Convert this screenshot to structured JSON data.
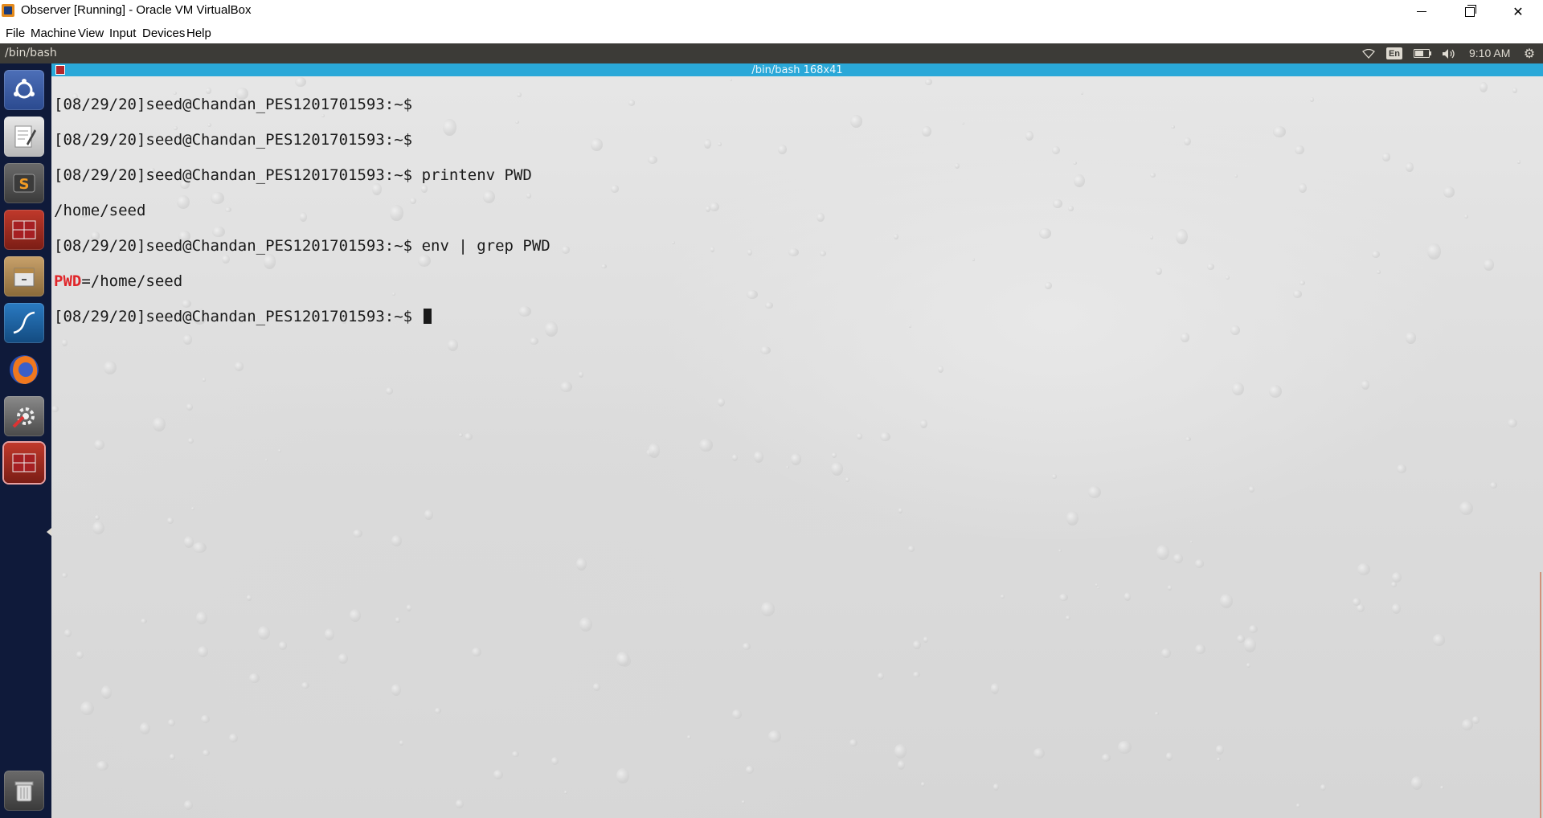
{
  "window": {
    "title": "Observer [Running] - Oracle VM VirtualBox",
    "controls": [
      "minimize",
      "maximize",
      "close"
    ]
  },
  "menubar": {
    "items": [
      "File",
      "Machine",
      "View",
      "Input",
      "Devices",
      "Help"
    ]
  },
  "panel": {
    "title": "/bin/bash",
    "lang": "En",
    "clock": "9:10 AM",
    "battery_level": 0.6,
    "icons": [
      "wifi-icon",
      "keyboard-layout-icon",
      "battery-icon",
      "volume-icon",
      "settings-gear-icon"
    ]
  },
  "launcher": {
    "items": [
      {
        "name": "ubuntu-dash",
        "icon": "ubuntu-logo-icon"
      },
      {
        "name": "text-editor",
        "icon": "text-editor-icon"
      },
      {
        "name": "sublime-text",
        "icon": "sublime-text-icon"
      },
      {
        "name": "terminal",
        "icon": "terminal-icon"
      },
      {
        "name": "files",
        "icon": "file-cabinet-icon"
      },
      {
        "name": "wireshark",
        "icon": "wireshark-fin-icon"
      },
      {
        "name": "firefox",
        "icon": "firefox-icon"
      },
      {
        "name": "system-settings",
        "icon": "wrench-gear-icon"
      },
      {
        "name": "terminal-active",
        "icon": "terminal-icon"
      },
      {
        "name": "trash",
        "icon": "trash-icon"
      }
    ]
  },
  "terminal": {
    "title": "/bin/bash 168x41",
    "lines": [
      {
        "prompt": "[08/29/20]seed@Chandan_PES1201701593:~$",
        "command": ""
      },
      {
        "prompt": "[08/29/20]seed@Chandan_PES1201701593:~$",
        "command": ""
      },
      {
        "prompt": "[08/29/20]seed@Chandan_PES1201701593:~$",
        "command": " printenv PWD"
      },
      {
        "output": "/home/seed"
      },
      {
        "prompt": "[08/29/20]seed@Chandan_PES1201701593:~$",
        "command": " env | grep PWD"
      },
      {
        "highlight": "PWD",
        "output": "=/home/seed"
      },
      {
        "prompt": "[08/29/20]seed@Chandan_PES1201701593:~$",
        "command": " "
      }
    ]
  },
  "colors": {
    "panel_bg": "#3c3b37",
    "launcher_bg": "#0f1a3a",
    "terminal_title_bg": "#2aa8d8",
    "grep_highlight": "#e0262a"
  }
}
